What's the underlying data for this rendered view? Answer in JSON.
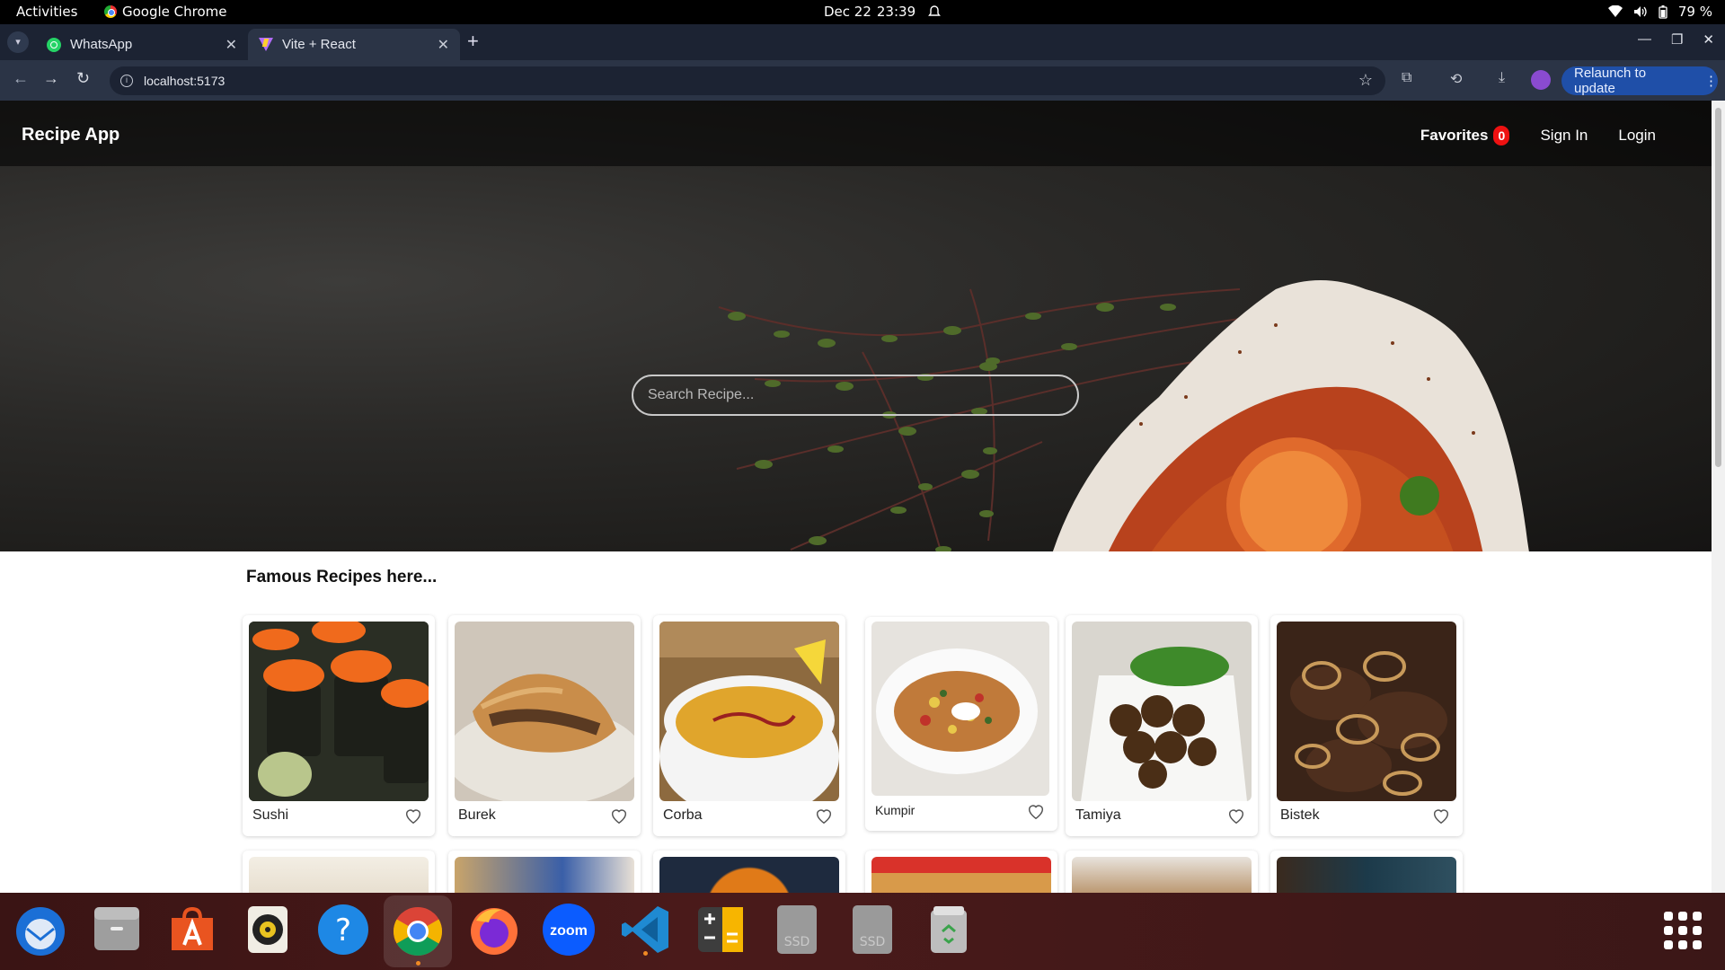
{
  "system_bar": {
    "activities": "Activities",
    "app_name": "Google Chrome",
    "date": "Dec 22",
    "time": "23:39",
    "battery": "79 %"
  },
  "browser": {
    "tabs": [
      {
        "title": "WhatsApp",
        "icon": "whatsapp-icon",
        "active": false
      },
      {
        "title": "Vite + React",
        "icon": "vite-icon",
        "active": true
      }
    ],
    "url": "localhost:5173",
    "relaunch_label": "Relaunch to update"
  },
  "app": {
    "brand": "Recipe App",
    "nav": {
      "favorites_label": "Favorites",
      "favorites_count": "0",
      "sign_in": "Sign In",
      "login": "Login"
    },
    "search": {
      "placeholder": "Search Recipe...",
      "value": ""
    },
    "section_title": "Famous Recipes here...",
    "recipes": [
      {
        "name": "Sushi"
      },
      {
        "name": "Burek"
      },
      {
        "name": "Corba"
      },
      {
        "name": "Kumpir"
      },
      {
        "name": "Tamiya"
      },
      {
        "name": "Bistek"
      }
    ]
  },
  "dock": {
    "apps": [
      "thunderbird-icon",
      "files-icon",
      "app-center-icon",
      "rhythmbox-icon",
      "help-icon",
      "chrome-icon",
      "firefox-icon",
      "zoom-icon",
      "vscode-icon",
      "calculator-icon",
      "ssd-drive-icon",
      "ssd-drive-icon",
      "trash-icon"
    ],
    "zoom_label": "zoom",
    "ssd_label": "SSD"
  },
  "colors": {
    "badge": "#ee1111",
    "relaunch_bg": "#1f4fa8",
    "dock_active_dot": "#f08a24"
  }
}
